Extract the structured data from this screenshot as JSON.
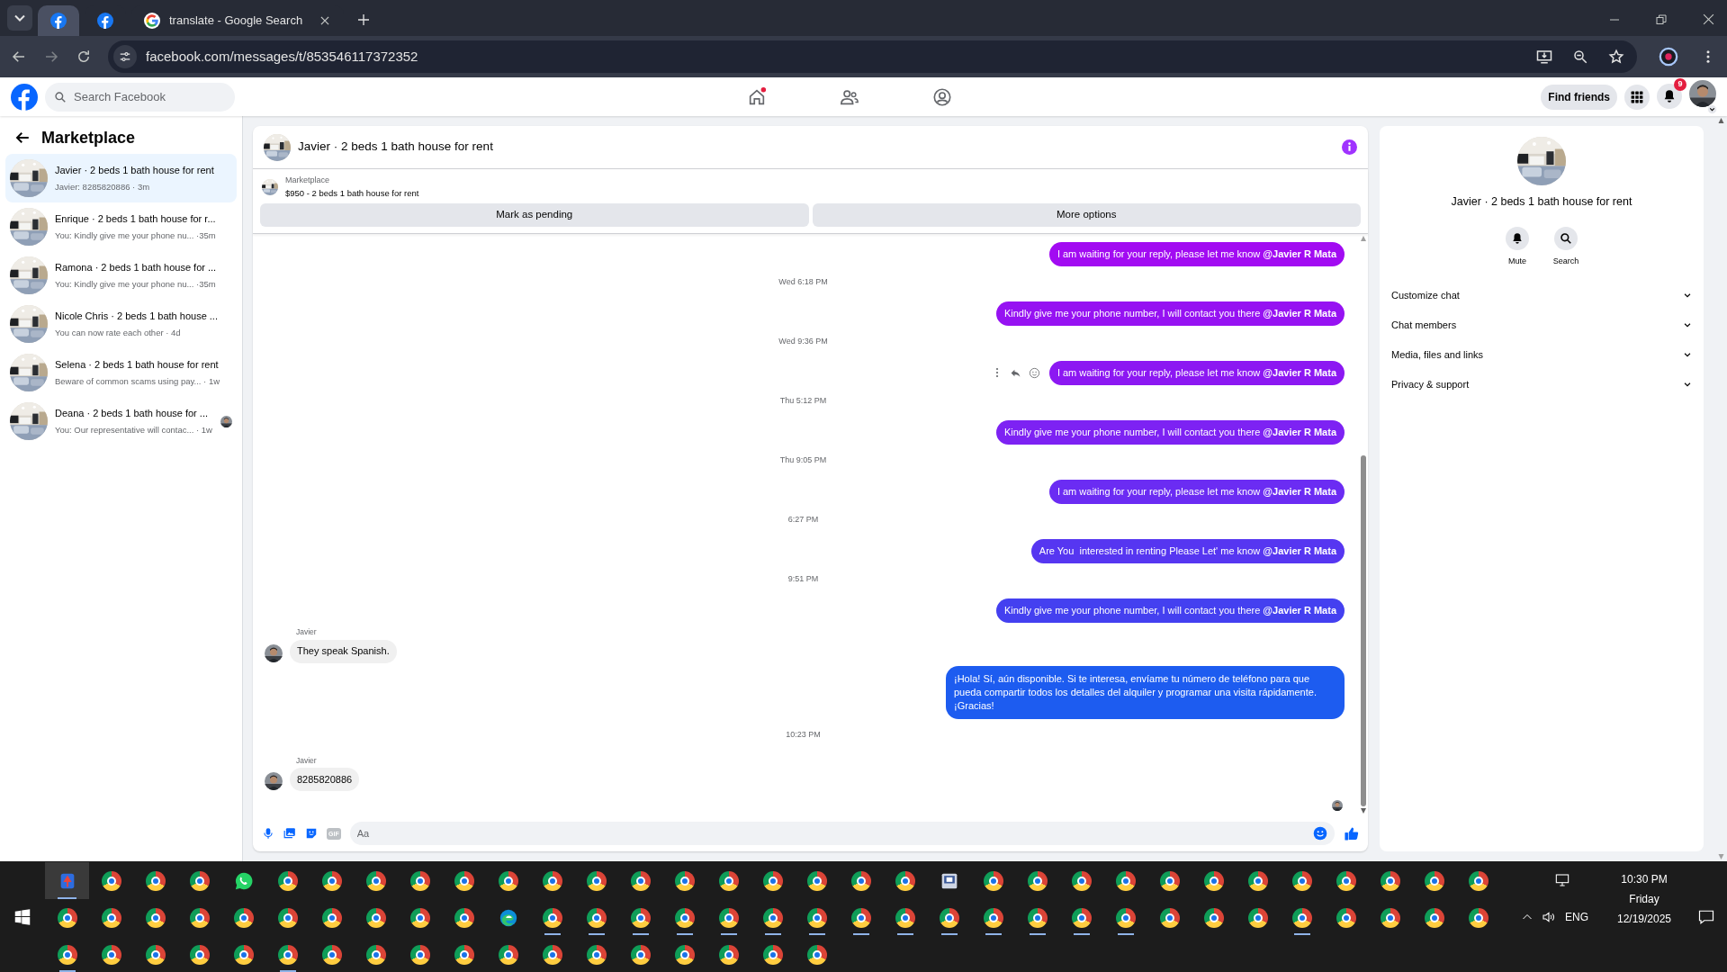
{
  "browser": {
    "tabs": [
      {
        "kind": "facebook",
        "selected": true
      },
      {
        "kind": "facebook",
        "selected": false
      },
      {
        "kind": "google",
        "title": "translate - Google Search",
        "selected": false
      }
    ],
    "url": "facebook.com/messages/t/853546117372352"
  },
  "facebook_header": {
    "search_placeholder": "Search Facebook",
    "nav": [
      {
        "kind": "home",
        "dot": true
      },
      {
        "kind": "friends",
        "dot": false
      },
      {
        "kind": "profile",
        "dot": false
      }
    ],
    "find_friends": "Find friends",
    "notification_count": "9"
  },
  "sidebar": {
    "title": "Marketplace",
    "items": [
      {
        "title": "Javier · 2 beds 1 bath house for rent",
        "preview": "Javier: 8285820886 · 3m",
        "selected": true,
        "seen": false
      },
      {
        "title": "Enrique · 2 beds 1 bath house for r...",
        "preview": "You: Kindly give me your phone nu...  ·35m",
        "selected": false,
        "seen": false
      },
      {
        "title": "Ramona · 2 beds 1 bath house for ...",
        "preview": "You: Kindly give me your phone nu...  ·35m",
        "selected": false,
        "seen": false
      },
      {
        "title": "Nicole Chris · 2 beds 1 bath house ...",
        "preview": "You can now rate each other · 4d",
        "selected": false,
        "seen": false
      },
      {
        "title": "Selena · 2 beds 1 bath house for rent",
        "preview": "Beware of common scams using pay...  · 1w",
        "selected": false,
        "seen": false
      },
      {
        "title": "Deana · 2 beds 1 bath house for ...",
        "preview": "You: Our representative will contac... · 1w",
        "selected": false,
        "seen": true
      }
    ]
  },
  "chat": {
    "title": "Javier · 2 beds 1 bath house for rent",
    "listing": {
      "label": "Marketplace",
      "detail": "$950 - 2 beds 1 bath house for rent"
    },
    "actions": [
      "Mark as pending",
      "More options"
    ],
    "messages": [
      {
        "kind": "sent",
        "text": "I am waiting for your reply, please let me know **@Javier R Mata**",
        "color": "#a20bf2",
        "hovered": false
      },
      {
        "kind": "time",
        "text": "Wed 6:18 PM"
      },
      {
        "kind": "sent",
        "text": "Kindly give me your phone number, I will contact you there **@Javier R Mata**",
        "color": "#9612f2",
        "hovered": false
      },
      {
        "kind": "time",
        "text": "Wed 9:36 PM"
      },
      {
        "kind": "sent",
        "text": "I am waiting for your reply, please let me know **@Javier R Mata**",
        "color": "#8c18f2",
        "hovered": true
      },
      {
        "kind": "time",
        "text": "Thu 5:12 PM"
      },
      {
        "kind": "sent",
        "text": "Kindly give me your phone number, I will contact you there **@Javier R Mata**",
        "color": "#7d22f3",
        "hovered": false
      },
      {
        "kind": "time",
        "text": "Thu 9:05 PM"
      },
      {
        "kind": "sent",
        "text": "I am waiting for your reply, please let me know **@Javier R Mata**",
        "color": "#6b2cf3",
        "hovered": false
      },
      {
        "kind": "time",
        "text": "6:27 PM"
      },
      {
        "kind": "sent",
        "text": "Are You  interested in renting Please Let' me know **@Javier R Mata**",
        "color": "#5636f1",
        "hovered": false
      },
      {
        "kind": "time",
        "text": "9:51 PM"
      },
      {
        "kind": "sent",
        "text": "Kindly give me your phone number, I will contact you there **@Javier R Mata**",
        "color": "#4440f0",
        "hovered": false
      },
      {
        "kind": "received",
        "sender": "Javier",
        "text": "They speak Spanish."
      },
      {
        "kind": "sent",
        "text": "¡Hola! Sí, aún disponible. Si te interesa, envíame tu número de teléfono para que pueda compartir todos los detalles del alquiler y programar una visita rápidamente. ¡Gracias!",
        "color": "#1d5cf0",
        "hovered": false
      },
      {
        "kind": "time",
        "text": "10:23 PM"
      },
      {
        "kind": "received",
        "sender": "Javier",
        "text": "8285820886"
      }
    ],
    "composer": {
      "gif_label": "GIF",
      "placeholder": "Aa"
    }
  },
  "details": {
    "title": "Javier · 2 beds 1 bath house for rent",
    "buttons": [
      {
        "kind": "mute",
        "label": "Mute"
      },
      {
        "kind": "search",
        "label": "Search"
      }
    ],
    "sections": [
      {
        "label": "Customize chat",
        "expanded": false
      },
      {
        "label": "Chat members",
        "expanded": false
      },
      {
        "label": "Media, files and links",
        "expanded": false
      },
      {
        "label": "Privacy & support",
        "expanded": false
      }
    ]
  },
  "taskbar": {
    "rows": [
      [
        {
          "kind": "app",
          "active": true
        },
        {
          "kind": "chrome",
          "active": false
        },
        {
          "kind": "chrome",
          "active": false
        },
        {
          "kind": "chrome",
          "active": false
        },
        {
          "kind": "whatsapp",
          "active": false
        },
        {
          "kind": "chrome",
          "active": false
        },
        {
          "kind": "chrome",
          "active": false
        },
        {
          "kind": "chrome",
          "active": false
        },
        {
          "kind": "chrome",
          "active": false
        },
        {
          "kind": "chrome",
          "active": false
        },
        {
          "kind": "chrome",
          "active": false
        },
        {
          "kind": "chrome",
          "active": false
        },
        {
          "kind": "chrome",
          "active": false
        },
        {
          "kind": "chrome",
          "active": false
        },
        {
          "kind": "chrome",
          "active": false
        },
        {
          "kind": "chrome",
          "active": false
        },
        {
          "kind": "chrome",
          "active": false
        },
        {
          "kind": "chrome",
          "active": false
        },
        {
          "kind": "chrome",
          "active": false
        },
        {
          "kind": "chrome",
          "active": false
        },
        {
          "kind": "window",
          "active": false
        },
        {
          "kind": "chrome",
          "active": false
        },
        {
          "kind": "chrome",
          "active": false
        },
        {
          "kind": "chrome",
          "active": false
        },
        {
          "kind": "chrome",
          "active": false
        },
        {
          "kind": "chrome",
          "active": false
        },
        {
          "kind": "chrome",
          "active": false
        },
        {
          "kind": "chrome",
          "active": false
        },
        {
          "kind": "chrome",
          "active": false
        },
        {
          "kind": "chrome",
          "active": false
        },
        {
          "kind": "chrome",
          "active": false
        },
        {
          "kind": "chrome",
          "active": false
        },
        {
          "kind": "chrome",
          "active": false
        }
      ],
      [
        {
          "kind": "chrome",
          "active": false
        },
        {
          "kind": "chrome",
          "active": false
        },
        {
          "kind": "chrome",
          "active": false
        },
        {
          "kind": "chrome",
          "active": false
        },
        {
          "kind": "chrome",
          "active": false
        },
        {
          "kind": "chrome",
          "active": false
        },
        {
          "kind": "chrome",
          "active": false
        },
        {
          "kind": "chrome",
          "active": false
        },
        {
          "kind": "chrome",
          "active": false
        },
        {
          "kind": "chrome",
          "active": false
        },
        {
          "kind": "edge",
          "active": false
        },
        {
          "kind": "chrome",
          "active": true
        },
        {
          "kind": "chrome",
          "active": true
        },
        {
          "kind": "chrome",
          "active": true
        },
        {
          "kind": "chrome",
          "active": true
        },
        {
          "kind": "chrome",
          "active": true
        },
        {
          "kind": "chrome",
          "active": true
        },
        {
          "kind": "chrome",
          "active": true
        },
        {
          "kind": "chrome",
          "active": true
        },
        {
          "kind": "chrome",
          "active": true
        },
        {
          "kind": "chrome",
          "active": true
        },
        {
          "kind": "chrome",
          "active": true
        },
        {
          "kind": "chrome",
          "active": true
        },
        {
          "kind": "chrome",
          "active": true
        },
        {
          "kind": "chrome",
          "active": true
        },
        {
          "kind": "chrome",
          "active": false
        },
        {
          "kind": "chrome",
          "active": false
        },
        {
          "kind": "chrome",
          "active": false
        },
        {
          "kind": "chrome",
          "active": true
        },
        {
          "kind": "chrome",
          "active": false
        },
        {
          "kind": "chrome",
          "active": false
        },
        {
          "kind": "chrome",
          "active": false
        },
        {
          "kind": "chrome",
          "active": false
        }
      ],
      [
        {
          "kind": "chrome",
          "active": true
        },
        {
          "kind": "chrome",
          "active": false
        },
        {
          "kind": "chrome",
          "active": false
        },
        {
          "kind": "chrome",
          "active": false
        },
        {
          "kind": "chrome",
          "active": false
        },
        {
          "kind": "chrome",
          "active": true
        },
        {
          "kind": "chrome",
          "active": false
        },
        {
          "kind": "chrome",
          "active": false
        },
        {
          "kind": "chrome",
          "active": false
        },
        {
          "kind": "chrome",
          "active": false
        },
        {
          "kind": "chrome",
          "active": false
        },
        {
          "kind": "chrome",
          "active": false
        },
        {
          "kind": "chrome",
          "active": false
        },
        {
          "kind": "chrome",
          "active": false
        },
        {
          "kind": "chrome",
          "active": false
        },
        {
          "kind": "chrome",
          "active": false
        },
        {
          "kind": "chrome",
          "active": false
        },
        {
          "kind": "chrome",
          "active": false
        }
      ]
    ],
    "tray": {
      "language": "ENG",
      "time": "10:30 PM",
      "day": "Friday",
      "date": "12/19/2025"
    }
  }
}
